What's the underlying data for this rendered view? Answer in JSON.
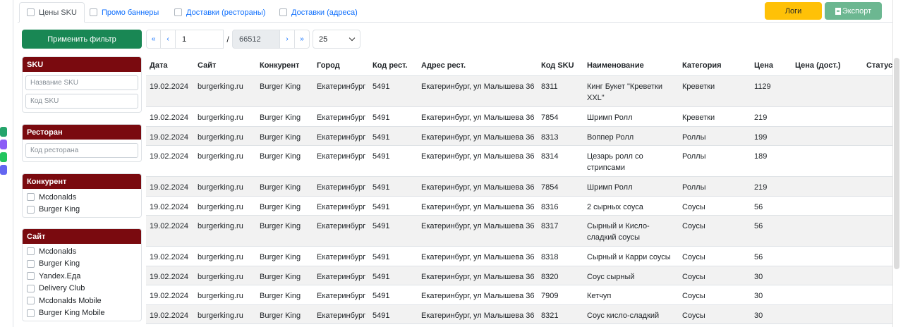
{
  "tabs": [
    {
      "label": "Цены SKU",
      "active": true
    },
    {
      "label": "Промо баннеры",
      "active": false
    },
    {
      "label": "Доставки (рестораны)",
      "active": false
    },
    {
      "label": "Доставки (адреса)",
      "active": false
    }
  ],
  "toolbar": {
    "logs_label": "Логи",
    "export_label": "Экспорт"
  },
  "filter": {
    "apply_label": "Применить фильтр"
  },
  "pager": {
    "first": "«",
    "prev": "‹",
    "page": "1",
    "slash": "/",
    "total": "66512",
    "next": "›",
    "last": "»",
    "page_size": "25"
  },
  "panels": {
    "sku": {
      "title": "SKU",
      "name_placeholder": "Название SKU",
      "code_placeholder": "Код SKU"
    },
    "restaurant": {
      "title": "Ресторан",
      "code_placeholder": "Код ресторана"
    },
    "competitor": {
      "title": "Конкурент",
      "items": [
        "Mcdonalds",
        "Burger King"
      ]
    },
    "site": {
      "title": "Сайт",
      "items": [
        "Mcdonalds",
        "Burger King",
        "Yandex.Еда",
        "Delivery Club",
        "Mcdonalds Mobile",
        "Burger King Mobile"
      ]
    }
  },
  "table": {
    "headers": [
      "Дата",
      "Сайт",
      "Конкурент",
      "Город",
      "Код рест.",
      "Адрес рест.",
      "Код SKU",
      "Наименование",
      "Категория",
      "Цена",
      "Цена (дост.)",
      "Статус"
    ],
    "rows": [
      [
        "19.02.2024",
        "burgerking.ru",
        "Burger King",
        "Екатеринбург",
        "5491",
        "Екатеринбург, ул Малышева 36",
        "8311",
        "Кинг Букет \"Креветки XXL\"",
        "Креветки",
        "1129",
        "",
        ""
      ],
      [
        "19.02.2024",
        "burgerking.ru",
        "Burger King",
        "Екатеринбург",
        "5491",
        "Екатеринбург, ул Малышева 36",
        "7854",
        "Шримп Ролл",
        "Креветки",
        "219",
        "",
        ""
      ],
      [
        "19.02.2024",
        "burgerking.ru",
        "Burger King",
        "Екатеринбург",
        "5491",
        "Екатеринбург, ул Малышева 36",
        "8313",
        "Воппер Ролл",
        "Роллы",
        "199",
        "",
        ""
      ],
      [
        "19.02.2024",
        "burgerking.ru",
        "Burger King",
        "Екатеринбург",
        "5491",
        "Екатеринбург, ул Малышева 36",
        "8314",
        "Цезарь ролл со стрипсами",
        "Роллы",
        "189",
        "",
        ""
      ],
      [
        "19.02.2024",
        "burgerking.ru",
        "Burger King",
        "Екатеринбург",
        "5491",
        "Екатеринбург, ул Малышева 36",
        "7854",
        "Шримп Ролл",
        "Роллы",
        "219",
        "",
        ""
      ],
      [
        "19.02.2024",
        "burgerking.ru",
        "Burger King",
        "Екатеринбург",
        "5491",
        "Екатеринбург, ул Малышева 36",
        "8316",
        "2 сырных соуса",
        "Соусы",
        "56",
        "",
        ""
      ],
      [
        "19.02.2024",
        "burgerking.ru",
        "Burger King",
        "Екатеринбург",
        "5491",
        "Екатеринбург, ул Малышева 36",
        "8317",
        "Сырный и Кисло-сладкий соусы",
        "Соусы",
        "56",
        "",
        ""
      ],
      [
        "19.02.2024",
        "burgerking.ru",
        "Burger King",
        "Екатеринбург",
        "5491",
        "Екатеринбург, ул Малышева 36",
        "8318",
        "Сырный и Карри соусы",
        "Соусы",
        "56",
        "",
        ""
      ],
      [
        "19.02.2024",
        "burgerking.ru",
        "Burger King",
        "Екатеринбург",
        "5491",
        "Екатеринбург, ул Малышева 36",
        "8320",
        "Соус сырный",
        "Соусы",
        "30",
        "",
        ""
      ],
      [
        "19.02.2024",
        "burgerking.ru",
        "Burger King",
        "Екатеринбург",
        "5491",
        "Екатеринбург, ул Малышева 36",
        "7909",
        "Кетчуп",
        "Соусы",
        "30",
        "",
        ""
      ],
      [
        "19.02.2024",
        "burgerking.ru",
        "Burger King",
        "Екатеринбург",
        "5491",
        "Екатеринбург, ул Малышева 36",
        "8321",
        "Соус кисло-сладкий",
        "Соусы",
        "30",
        "",
        ""
      ]
    ]
  }
}
